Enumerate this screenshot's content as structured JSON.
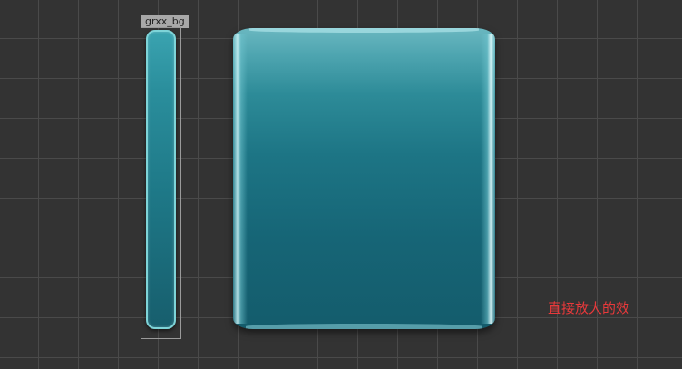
{
  "asset": {
    "label": "grxx_bg"
  },
  "caption": {
    "text": "直接放大的效"
  }
}
